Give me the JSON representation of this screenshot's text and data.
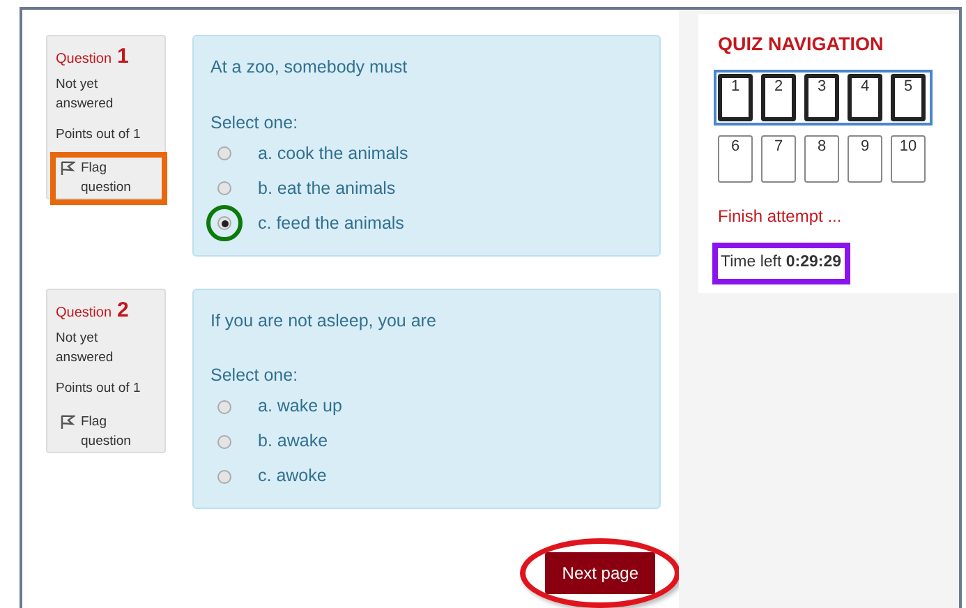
{
  "questions": [
    {
      "label": "Question",
      "number": "1",
      "status": "Not yet answered",
      "points": "Points out of 1",
      "flag": "Flag question",
      "flag_highlighted": true,
      "text": "At a zoo, somebody must",
      "prompt": "Select one:",
      "options": [
        {
          "label": "a. cook the animals",
          "selected": false
        },
        {
          "label": "b. eat the animals",
          "selected": false
        },
        {
          "label": "c. feed the animals",
          "selected": true
        }
      ]
    },
    {
      "label": "Question",
      "number": "2",
      "status": "Not yet answered",
      "points": "Points out of 1",
      "flag": "Flag question",
      "flag_highlighted": false,
      "text": "If you are not asleep, you are",
      "prompt": "Select one:",
      "options": [
        {
          "label": "a. wake up",
          "selected": false
        },
        {
          "label": "b. awake",
          "selected": false
        },
        {
          "label": "c. awoke",
          "selected": false
        }
      ]
    }
  ],
  "next_button": "Next page",
  "navigation": {
    "title": "QUIZ NAVIGATION",
    "buttons": [
      {
        "label": "1",
        "on_page": true
      },
      {
        "label": "2",
        "on_page": true
      },
      {
        "label": "3",
        "on_page": true
      },
      {
        "label": "4",
        "on_page": true
      },
      {
        "label": "5",
        "on_page": true
      },
      {
        "label": "6",
        "on_page": false
      },
      {
        "label": "7",
        "on_page": false
      },
      {
        "label": "8",
        "on_page": false
      },
      {
        "label": "9",
        "on_page": false
      },
      {
        "label": "10",
        "on_page": false
      }
    ],
    "finish": "Finish attempt ...",
    "time": "Time left **0:29:29**"
  }
}
